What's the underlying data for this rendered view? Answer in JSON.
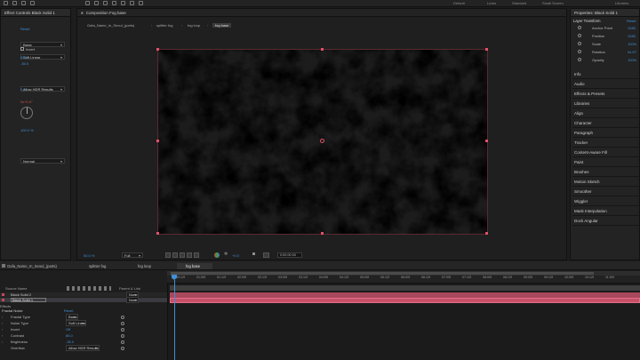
{
  "workspaces": [
    "Default",
    "Learn",
    "Standard",
    "Small Screen",
    "Libraries"
  ],
  "effect_controls": {
    "tab_label": "Effect Controls Black Solid 1",
    "reset": "Reset",
    "fractal_type": "Basic",
    "noise_type": "Soft Linear",
    "invert": "Invert",
    "contrast": "85.0",
    "brightness": "-35.0",
    "overflow": "Allow HDR Results",
    "scale_value": "0.3",
    "rotation": "0x+0.0°",
    "opacity": "100.0 %",
    "blending": "Normal"
  },
  "composition": {
    "tab_label": "Composition Fog base",
    "crumbs": [
      "Gafa_Name_In_Seoul_(parts)",
      "splitter fog",
      "fog loop",
      "fog base"
    ],
    "zoom": "50.0 %",
    "resolution": "Full",
    "exposure": "+0.0",
    "timecode": "0:00:00:00"
  },
  "properties": {
    "tab_label": "Properties: Black Solid 1",
    "section": "Layer Transform",
    "reset": "Reset",
    "rows": [
      {
        "label": "Anchor Point",
        "value": "1280"
      },
      {
        "label": "Position",
        "value": "1280"
      },
      {
        "label": "Scale",
        "value": "100%"
      },
      {
        "label": "Rotation",
        "value": "0x+0°"
      },
      {
        "label": "Opacity",
        "value": "100%"
      }
    ]
  },
  "right_panels": [
    "Info",
    "Audio",
    "Effects & Presets",
    "Libraries",
    "Align",
    "Character",
    "Paragraph",
    "Tracker",
    "Content-Aware Fill",
    "Paint",
    "Brushes",
    "Motion Sketch",
    "Smoother",
    "Wiggler",
    "Mask Interpolation",
    "Dock Angular"
  ],
  "timeline": {
    "tabs": [
      "Gafa_Name_In_Seoul_(parts)",
      "splitter fog",
      "fog loop",
      "fog base"
    ],
    "active_tab": "fog base",
    "col_source": "Source Name",
    "col_parent": "Parent & Link",
    "layers": [
      {
        "name": "Black Solid 2",
        "parent": "None"
      },
      {
        "name": "Black Solid 1",
        "parent": "None"
      }
    ],
    "section": "Effects",
    "effect": "Fractal Noise",
    "effect_reset": "Reset",
    "props": [
      {
        "label": "Fractal Type",
        "value": "Basic"
      },
      {
        "label": "Noise Type",
        "value": "Soft Linear"
      },
      {
        "label": "Invert",
        "value": "Off"
      },
      {
        "label": "Contrast",
        "value": "85.0"
      },
      {
        "label": "Brightness",
        "value": "-35.0"
      },
      {
        "label": "Overflow",
        "value": "Allow HDR Results"
      }
    ],
    "ticks": [
      "00:12f",
      "01:00f",
      "01:12f",
      "02:00f",
      "02:12f",
      "03:00f",
      "03:12f",
      "04:00f",
      "04:12f",
      "05:00f",
      "05:12f",
      "06:00f",
      "06:12f",
      "07:00f",
      "07:12f",
      "08:00f",
      "08:12f",
      "09:00f",
      "09:12f",
      "10:00f",
      "10:12f",
      "11:00f"
    ]
  }
}
